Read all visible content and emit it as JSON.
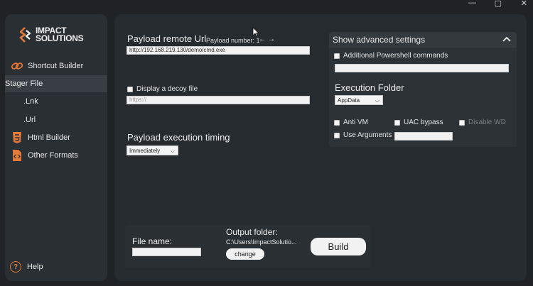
{
  "app": {
    "logo_line1": "IMPACT",
    "logo_line2": "SOLUTIONS",
    "brand_color": "#e0793a"
  },
  "sidebar": {
    "items": [
      {
        "label": "Shortcut Builder",
        "icon": "link-icon"
      },
      {
        "label": "Stager File",
        "icon": ""
      },
      {
        "label": ".Lnk",
        "icon": ""
      },
      {
        "label": ".Url",
        "icon": ""
      },
      {
        "label": "Html Builder",
        "icon": "html5-icon"
      },
      {
        "label": "Other Formats",
        "icon": "file-code-icon"
      }
    ],
    "help_label": "Help"
  },
  "payload": {
    "title": "Payload remote Url",
    "number_label": "Payload number: 1",
    "url_value": "http://192.168.219.130/demo/cmd.exe"
  },
  "decoy": {
    "label": "Display a decoy file",
    "placeholder": "https://"
  },
  "timing": {
    "title": "Payload execution timing",
    "selected": "Immediately"
  },
  "advanced": {
    "header": "Show advanced settings",
    "powershell_label": "Additional Powershell commands",
    "execution_folder_title": "Execution Folder",
    "execution_folder_selected": "AppData",
    "anti_vm_label": "Anti VM",
    "uac_bypass_label": "UAC bypass",
    "disable_wd_label": "Disable WD",
    "use_arguments_label": "Use Arguments"
  },
  "output": {
    "file_name_label": "File name:",
    "output_folder_label": "Output folder:",
    "output_folder_path": "C:\\Users\\ImpactSolutio...",
    "change_label": "change",
    "build_label": "Build"
  }
}
